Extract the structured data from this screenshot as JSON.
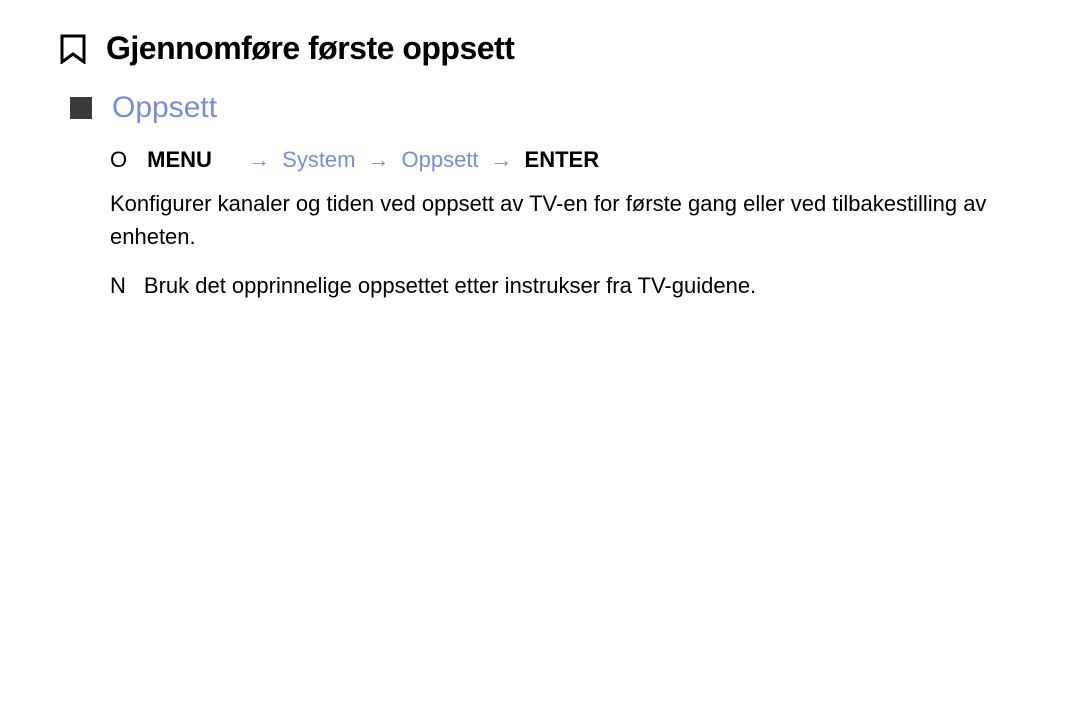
{
  "title": "Gjennomføre første oppsett",
  "section": "Oppsett",
  "path": {
    "o_marker": "O",
    "menu": "MENU",
    "arrow": "→",
    "system": "System",
    "oppsett": "Oppsett",
    "enter": "ENTER"
  },
  "description": "Konfigurer kanaler og tiden ved oppsett av TV-en for første gang eller ved tilbakestilling av enheten.",
  "note": {
    "marker": "N",
    "text": "Bruk det opprinnelige oppsettet etter instrukser fra TV-guidene."
  }
}
